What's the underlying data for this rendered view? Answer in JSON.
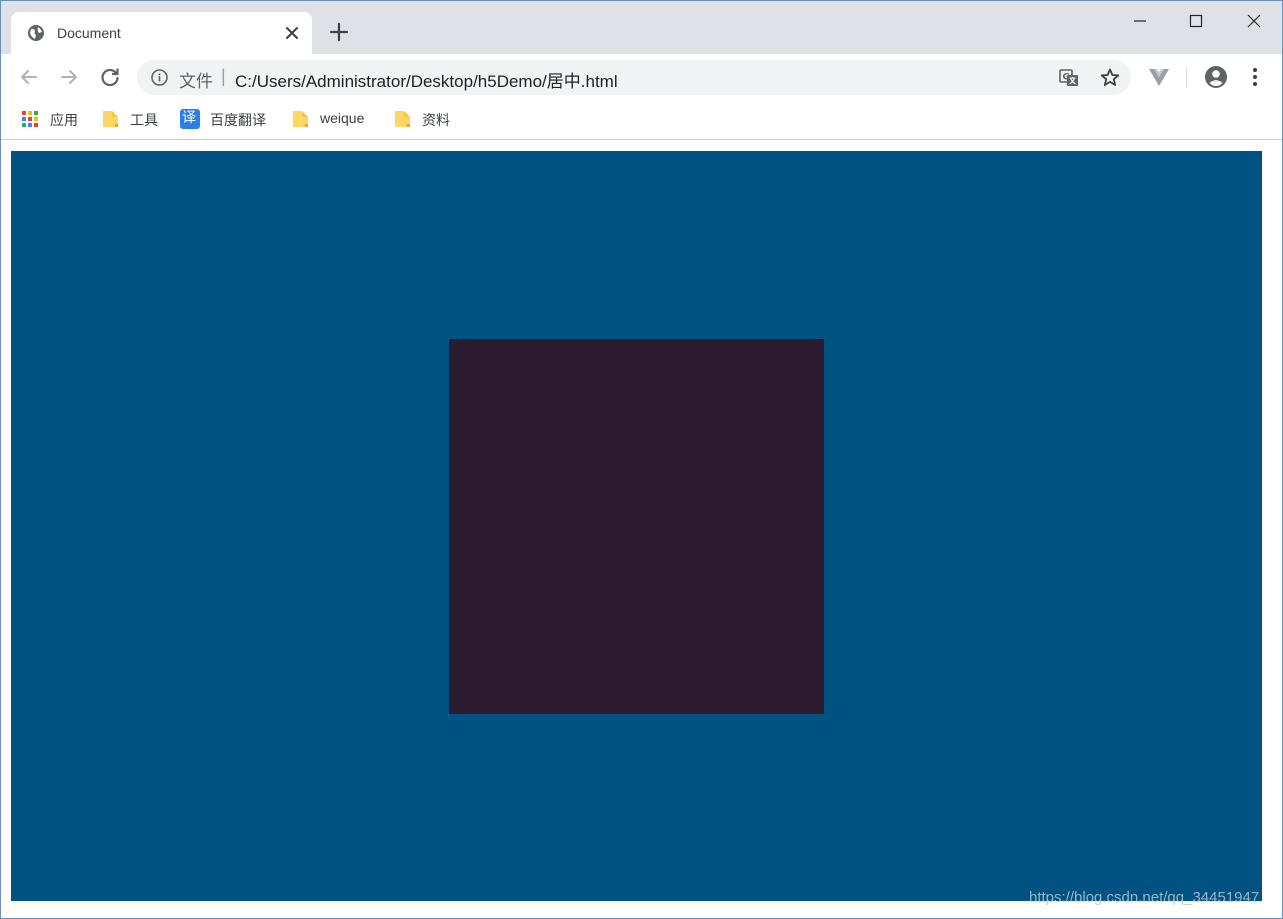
{
  "tab": {
    "title": "Document"
  },
  "address_bar": {
    "scheme_label": "文件",
    "separator": "|",
    "url": "C:/Users/Administrator/Desktop/h5Demo/居中.html"
  },
  "bookmarks": [
    {
      "label": "应用",
      "icon": "apps-grid-icon"
    },
    {
      "label": "工具",
      "icon": "folder-icon"
    },
    {
      "label": "百度翻译",
      "icon": "translate-badge-icon",
      "badge_text": "译"
    },
    {
      "label": "weique",
      "icon": "folder-icon"
    },
    {
      "label": "资料",
      "icon": "folder-icon"
    }
  ],
  "page": {
    "outer_color": "#005282",
    "inner_color": "#2d1b30",
    "watermark": "https://blog.csdn.net/qq_34451947"
  },
  "colors": {
    "tabstrip": "#dee1e6",
    "omnibox": "#f1f3f4",
    "folder": "#fdd663",
    "baidu_blue": "#2a7fe6"
  }
}
